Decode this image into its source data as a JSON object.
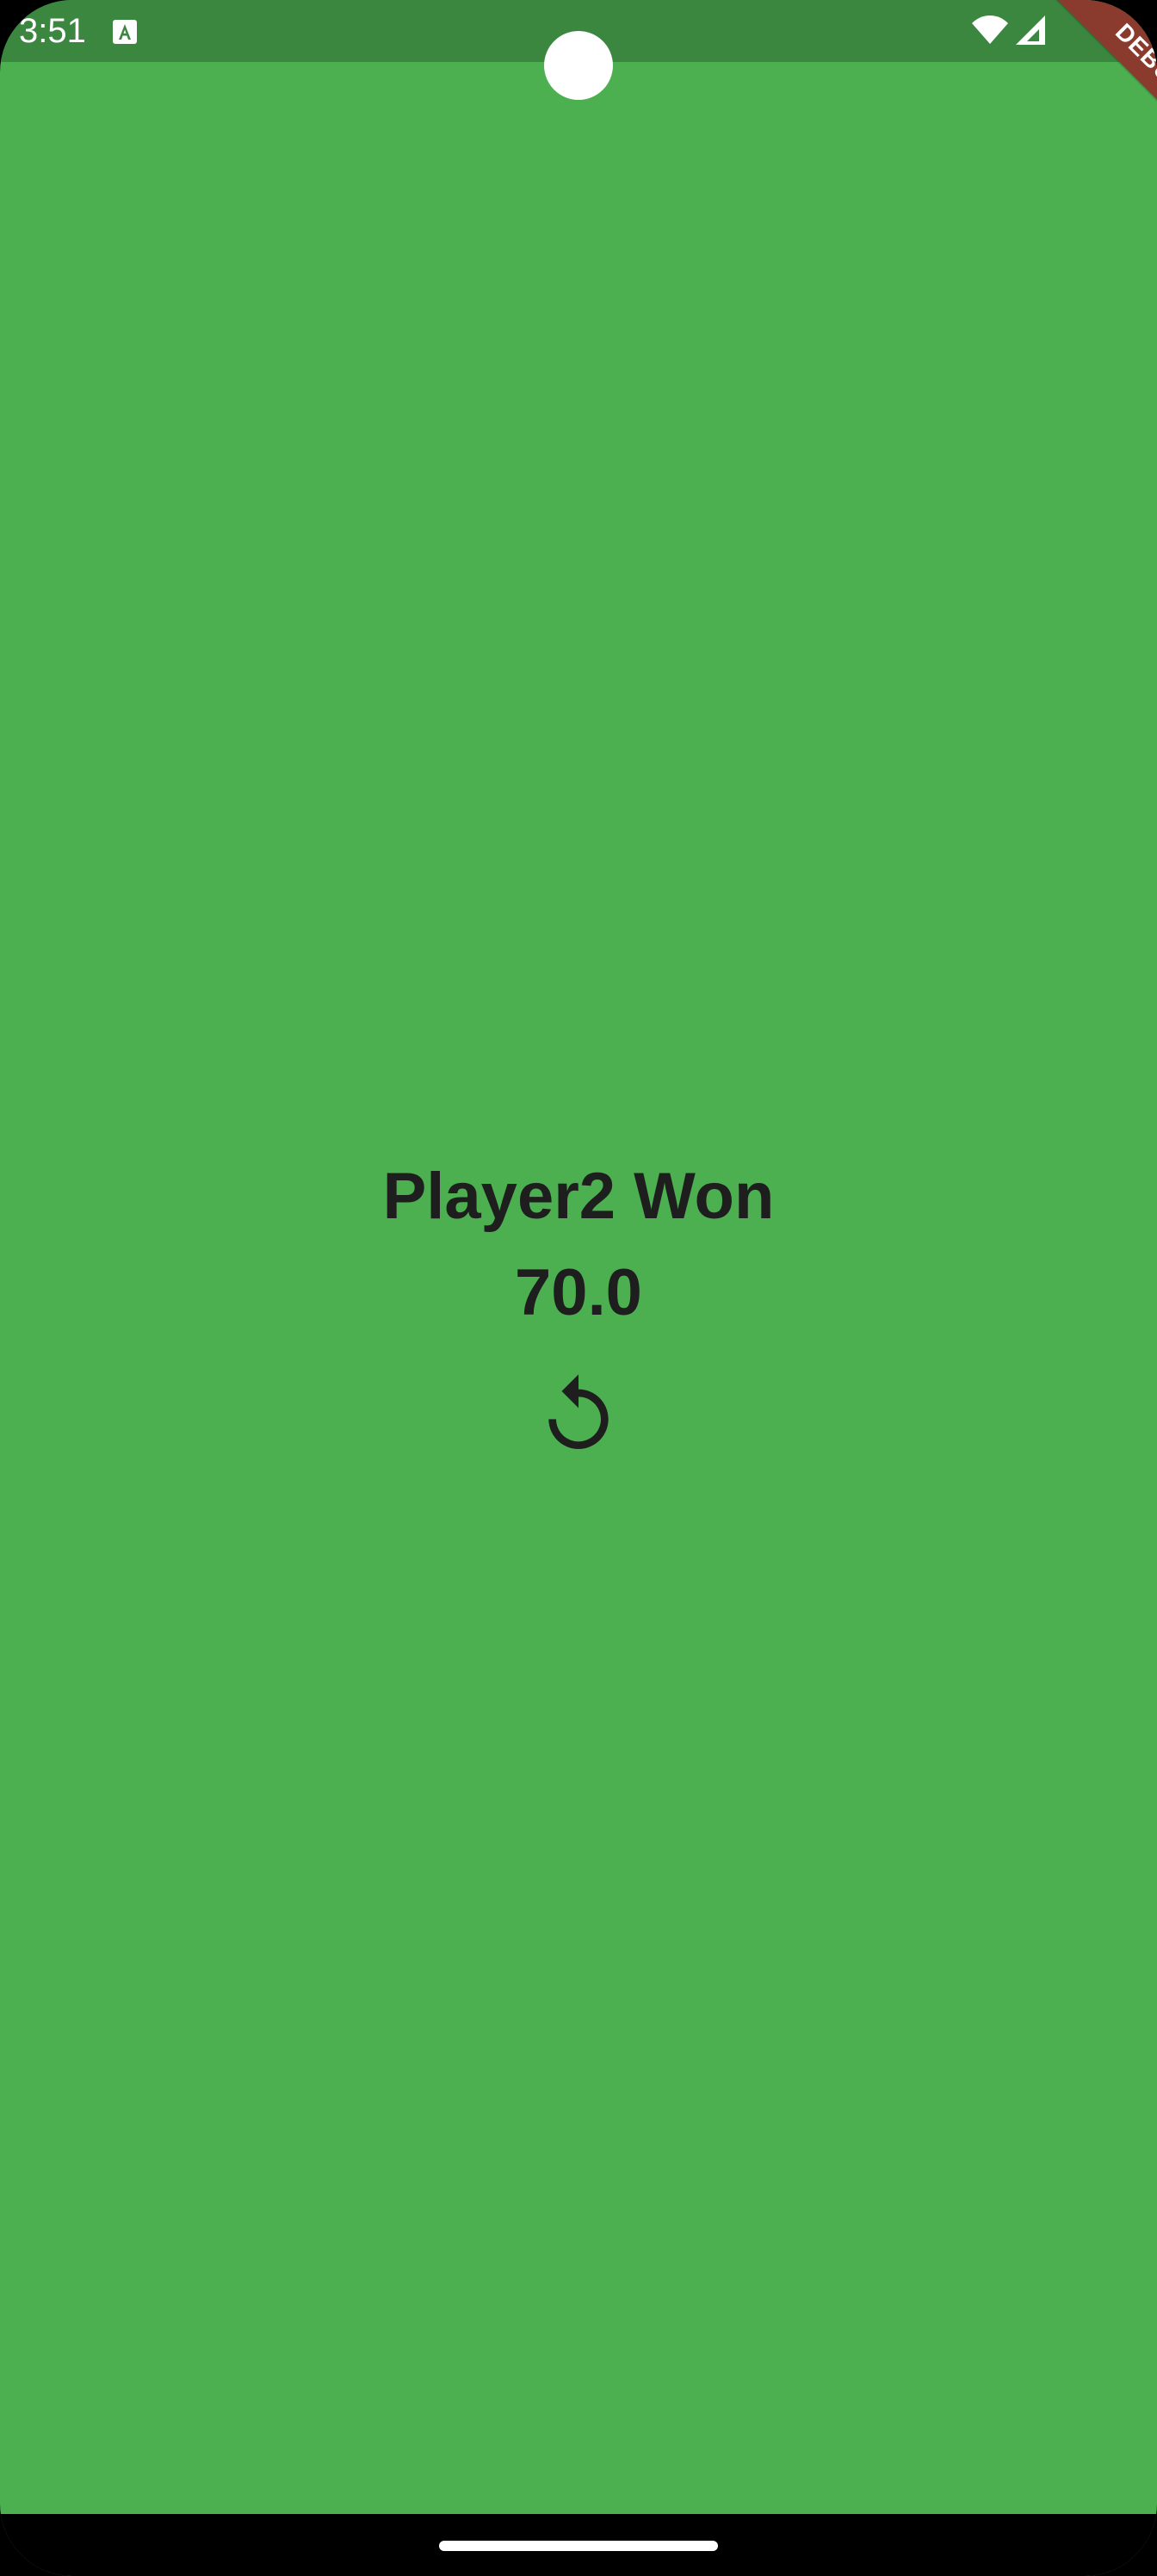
{
  "status_bar": {
    "time": "3:51",
    "app_icon": "text-a-icon",
    "wifi_icon": "wifi-icon",
    "signal_icon": "signal-icon"
  },
  "debug_banner": {
    "label": "DEBUG"
  },
  "game_over": {
    "winner_text": "Player2 Won",
    "score_text": "70.0",
    "restart_icon": "restart-icon"
  },
  "colors": {
    "background": "#4caf50",
    "status_bar_bg": "#3b8740",
    "text": "#1e1e1e",
    "debug_banner": "#8b3b2e"
  }
}
